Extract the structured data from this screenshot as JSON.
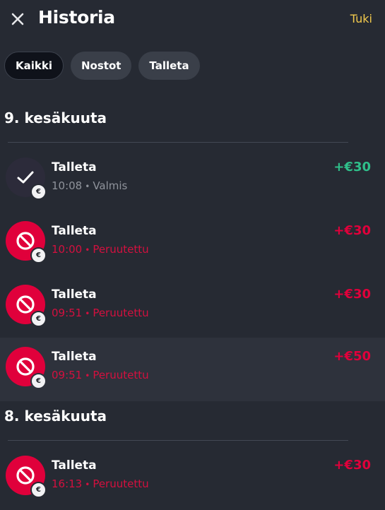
{
  "header": {
    "title": "Historia",
    "support_label": "Tuki",
    "close_icon": "close-icon"
  },
  "filters": [
    {
      "label": "Kaikki",
      "active": true
    },
    {
      "label": "Nostot",
      "active": false
    },
    {
      "label": "Talleta",
      "active": false
    }
  ],
  "sections": [
    {
      "date": "9. kesäkuuta",
      "transactions": [
        {
          "label": "Talleta",
          "time": "10:08",
          "status": "Valmis",
          "amount": "+€30",
          "state": "completed",
          "icon": "check-icon",
          "badge": "€"
        },
        {
          "label": "Talleta",
          "time": "10:00",
          "status": "Peruutettu",
          "amount": "+€30",
          "state": "cancelled",
          "icon": "prohibited-icon",
          "badge": "€"
        },
        {
          "label": "Talleta",
          "time": "09:51",
          "status": "Peruutettu",
          "amount": "+€30",
          "state": "cancelled",
          "icon": "prohibited-icon",
          "badge": "€"
        },
        {
          "label": "Talleta",
          "time": "09:51",
          "status": "Peruutettu",
          "amount": "+€50",
          "state": "cancelled",
          "icon": "prohibited-icon",
          "badge": "€"
        }
      ]
    },
    {
      "date": "8. kesäkuuta",
      "transactions": [
        {
          "label": "Talleta",
          "time": "16:13",
          "status": "Peruutettu",
          "amount": "+€30",
          "state": "cancelled",
          "icon": "prohibited-icon",
          "badge": "€"
        }
      ]
    }
  ],
  "colors": {
    "background": "#262a33",
    "accent_yellow": "#f2c94c",
    "success": "#2fbf8a",
    "cancelled": "#e0003b"
  }
}
